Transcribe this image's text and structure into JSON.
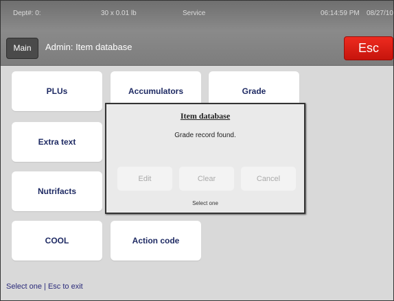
{
  "statusbar": {
    "dept": "Dept#: 0:",
    "weight": "30 x 0.01 lb",
    "mode": "Service",
    "time": "06:14:59 PM",
    "date": "08/27/10"
  },
  "header": {
    "main_label": "Main",
    "title": "Admin: Item database",
    "esc_label": "Esc",
    "esc_color": "#e41f16"
  },
  "tiles": {
    "plus": "PLUs",
    "accumulators": "Accumulators",
    "grade": "Grade",
    "extra_text": "Extra text",
    "nutrifacts": "Nutrifacts",
    "cool": "COOL",
    "action_code": "Action code"
  },
  "dialog": {
    "title": "Item database",
    "message": "Grade record found.",
    "edit_label": "Edit",
    "clear_label": "Clear",
    "cancel_label": "Cancel",
    "prompt": "Select one"
  },
  "footer": {
    "hint": "Select one | Esc to exit"
  }
}
